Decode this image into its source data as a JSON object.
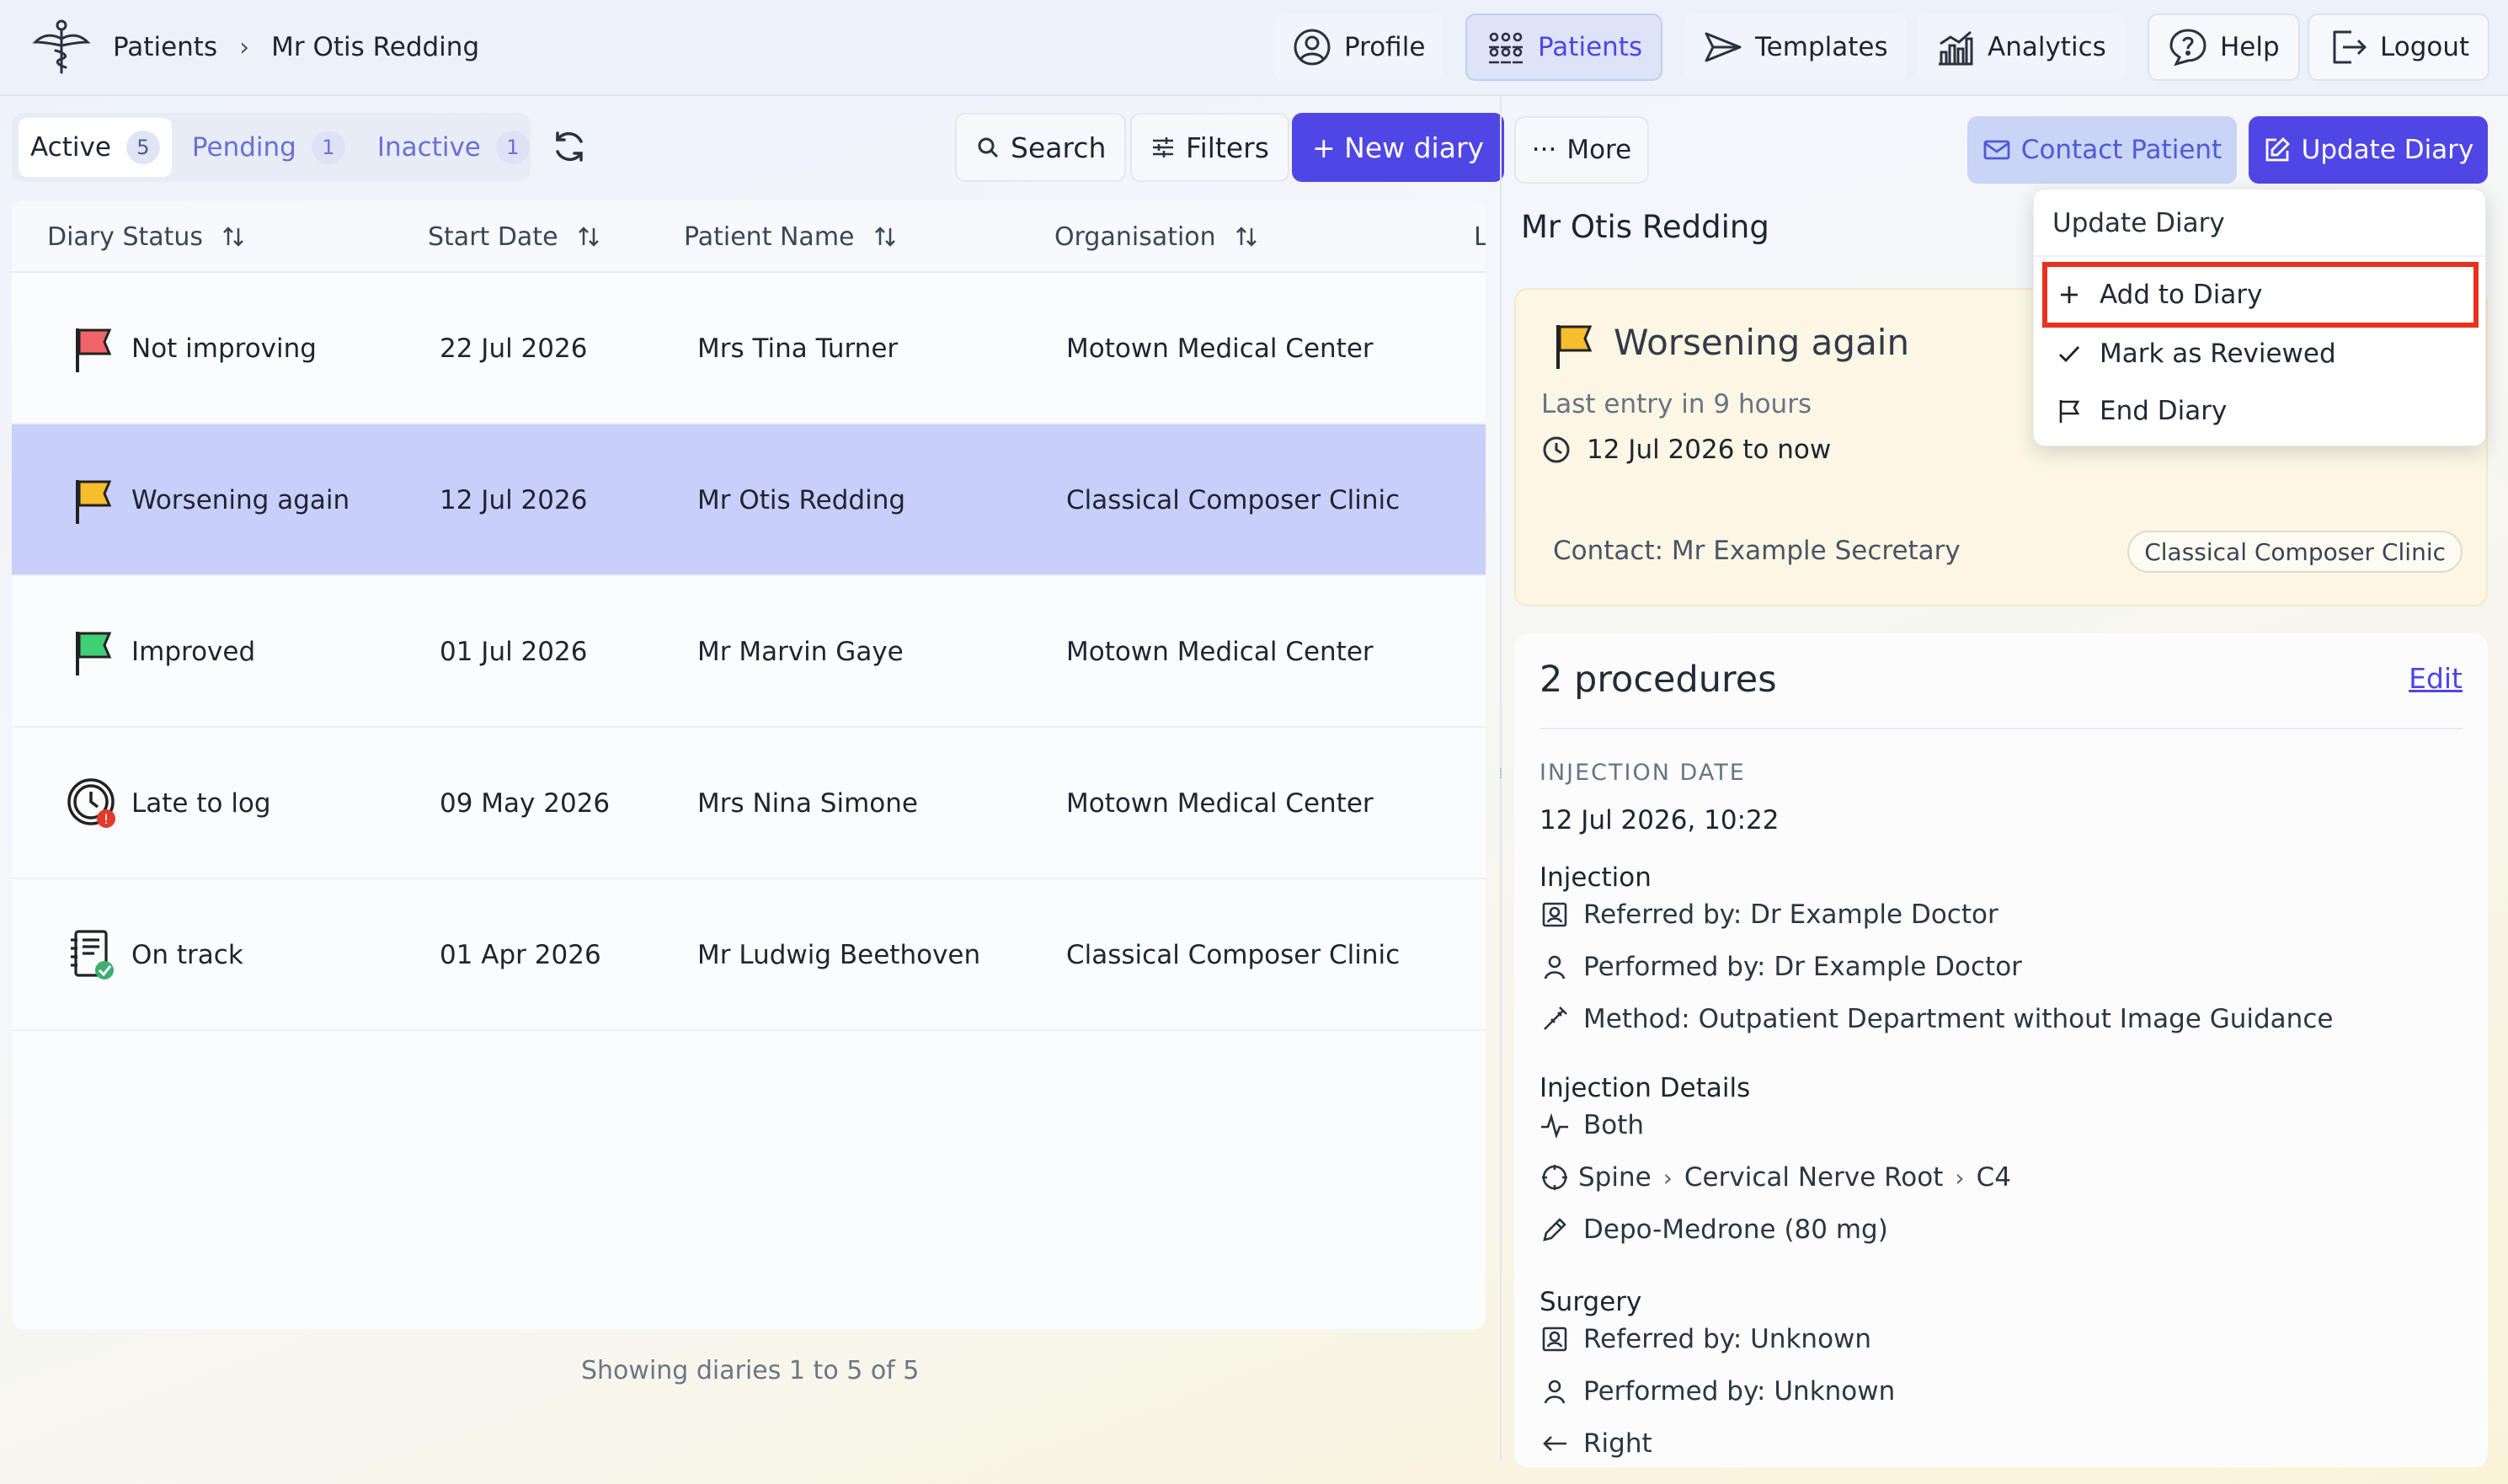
{
  "breadcrumb": {
    "items": [
      "Patients",
      "Mr Otis Redding"
    ]
  },
  "nav": {
    "profile": "Profile",
    "patients": "Patients",
    "templates": "Templates",
    "analytics": "Analytics",
    "help": "Help",
    "logout": "Logout"
  },
  "tabs": [
    {
      "label": "Active",
      "count": "5"
    },
    {
      "label": "Pending",
      "count": "1"
    },
    {
      "label": "Inactive",
      "count": "1"
    }
  ],
  "toolbar": {
    "search": "Search",
    "filters": "Filters",
    "new_diary": "+ New diary"
  },
  "table": {
    "columns": [
      "Diary Status",
      "Start Date",
      "Patient Name",
      "Organisation",
      "L"
    ],
    "rows": [
      {
        "status": "Not improving",
        "icon": "red-flag-icon",
        "start": "22 Jul 2026",
        "patient": "Mrs Tina Turner",
        "org": "Motown Medical Center"
      },
      {
        "status": "Worsening again",
        "icon": "yellow-flag-icon",
        "start": "12 Jul 2026",
        "patient": "Mr Otis Redding",
        "org": "Classical Composer Clinic"
      },
      {
        "status": "Improved",
        "icon": "green-flag-icon",
        "start": "01 Jul 2026",
        "patient": "Mr Marvin Gaye",
        "org": "Motown Medical Center"
      },
      {
        "status": "Late to log",
        "icon": "late-clock-icon",
        "start": "09 May 2026",
        "patient": "Mrs Nina Simone",
        "org": "Motown Medical Center"
      },
      {
        "status": "On track",
        "icon": "diary-check-icon",
        "start": "01 Apr 2026",
        "patient": "Mr Ludwig Beethoven",
        "org": "Classical Composer Clinic"
      }
    ],
    "footer": "Showing diaries 1 to 5 of 5"
  },
  "detail": {
    "more": "More",
    "contact_patient": "Contact Patient",
    "update_diary": "Update Diary",
    "patient_name": "Mr Otis Redding",
    "status": {
      "title": "Worsening again",
      "last_entry": "Last entry in 9 hours",
      "range": "12 Jul 2026 to now",
      "contact": "Contact: Mr Example Secretary",
      "org": "Classical Composer Clinic"
    },
    "procedures": {
      "title": "2 procedures",
      "edit": "Edit",
      "injection_date_label": "INJECTION DATE",
      "injection_date": "12 Jul 2026, 10:22",
      "injection_heading": "Injection",
      "referred": "Referred by: Dr Example Doctor",
      "performed": "Performed by: Dr Example Doctor",
      "method": "Method: Outpatient Department without Image Guidance",
      "details_heading": "Injection Details",
      "side": "Both",
      "location": [
        "Spine",
        "Cervical Nerve Root",
        "C4"
      ],
      "drug": "Depo-Medrone (80 mg)",
      "surgery_heading": "Surgery",
      "surgery_referred": "Referred by: Unknown",
      "surgery_performed": "Performed by: Unknown",
      "surgery_side": "Right"
    }
  },
  "dropdown": {
    "header": "Update Diary",
    "items": [
      "Add to Diary",
      "Mark as Reviewed",
      "End Diary"
    ]
  },
  "colors": {
    "accent": "#4f46e5",
    "selected_row": "#c7cffa",
    "highlight_outline": "#e8321e"
  }
}
